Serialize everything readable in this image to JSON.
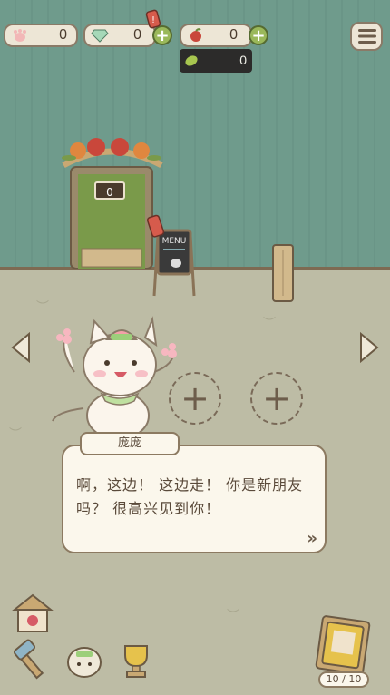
{
  "topbar": {
    "paws": "0",
    "gems": "0",
    "apples": "0",
    "leaves": "0",
    "icons": [
      "paw-icon",
      "gem-icon",
      "apple-icon",
      "leaf-icon",
      "menu-icon"
    ]
  },
  "scene": {
    "door_count": "0",
    "menu_board": "MENU"
  },
  "dialog": {
    "speaker": "庞庞",
    "text": "啊，这边！ 这边走！ 你是新朋友吗？ 很高兴见到你！",
    "next": "»"
  },
  "slots": [
    {
      "label": "+"
    },
    {
      "label": "+"
    }
  ],
  "cards": {
    "count": "10 / 10"
  },
  "colors": {
    "wall": "#6f9b8c",
    "floor": "#bdbca5",
    "accent_green": "#9ab85a"
  }
}
